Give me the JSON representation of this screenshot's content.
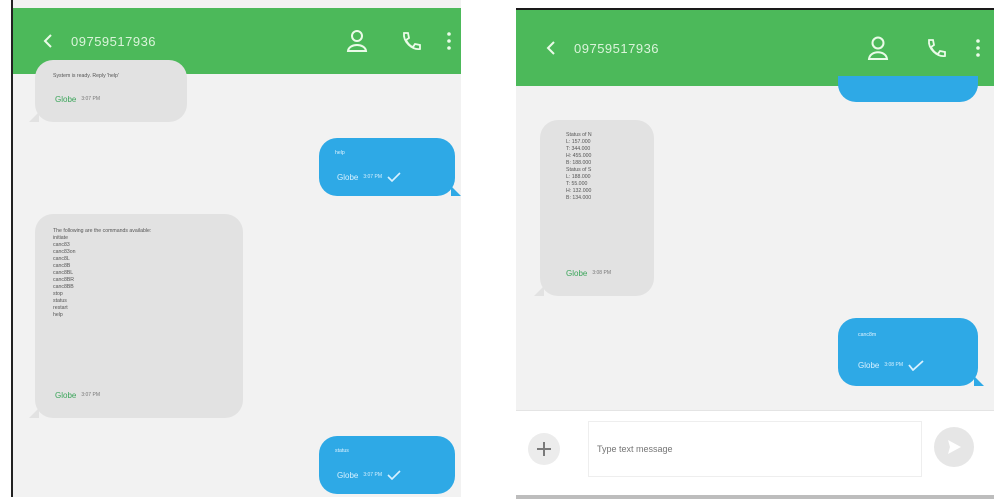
{
  "screens": [
    {
      "contact": "09759517936",
      "messages": [
        {
          "direction": "in",
          "text": "System is ready. Reply 'help'",
          "sender": "Globe",
          "time": "3:07 PM"
        },
        {
          "direction": "out",
          "text": "help",
          "sender": "Globe",
          "time": "3:07 PM"
        },
        {
          "direction": "in",
          "text": "The following are the commands available:\ninitiate\ncanc83\ncanc83on\ncanc8L\ncanc8B\ncanc8BL\ncanc8BR\ncanc8BB\nstop\nstatus\nrestart\nhelp",
          "sender": "Globe",
          "time": "3:07 PM"
        },
        {
          "direction": "out",
          "text": "status",
          "sender": "Globe",
          "time": "3:07 PM"
        }
      ]
    },
    {
      "contact": "09759517936",
      "messages": [
        {
          "direction": "out",
          "text": "",
          "sender": "",
          "time": ""
        },
        {
          "direction": "in",
          "text": "Status of N\nL: 157.000\nT: 344.000\nH: 455.000\nB: 188.000\nStatus of S\nL: 188.000\nT: 55.000\nH: 132.000\nB: 134.000",
          "sender": "Globe",
          "time": "3:08 PM"
        },
        {
          "direction": "out",
          "text": "canc8m",
          "sender": "Globe",
          "time": "3:08 PM"
        }
      ],
      "composer": {
        "placeholder": "Type text message"
      }
    }
  ],
  "colors": {
    "appbar": "#4cb95a",
    "outgoing": "#2ea9e6",
    "incoming": "#e2e2e2",
    "background": "#f2f2f2"
  },
  "icons": {
    "back": "chevron-left-icon",
    "contact": "person-icon",
    "call": "phone-icon",
    "menu": "more-vertical-icon",
    "attach": "plus-icon",
    "send": "send-icon"
  }
}
